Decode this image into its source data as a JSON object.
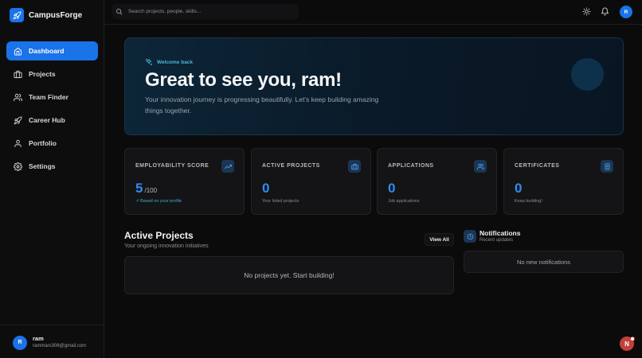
{
  "brand": {
    "name": "CampusForge"
  },
  "sidebar": {
    "items": [
      {
        "label": "Dashboard",
        "icon": "home-icon"
      },
      {
        "label": "Projects",
        "icon": "briefcase-icon"
      },
      {
        "label": "Team Finder",
        "icon": "users-icon"
      },
      {
        "label": "Career Hub",
        "icon": "rocket-icon"
      },
      {
        "label": "Portfolio",
        "icon": "user-icon"
      },
      {
        "label": "Settings",
        "icon": "gear-icon"
      }
    ],
    "active": "Dashboard",
    "user": {
      "initial": "R",
      "name": "ram",
      "email": "rammars306@gmail.com"
    }
  },
  "topbar": {
    "search_placeholder": "Search projects, people, skills...",
    "avatar_initial": "R"
  },
  "hero": {
    "tag": "Welcome back",
    "title": "Great to see you, ram!",
    "subtitle": "Your innovation journey is progressing beautifully. Let's keep building amazing things together."
  },
  "stats": [
    {
      "label": "EMPLOYABILITY SCORE",
      "value": "5",
      "unit": "/100",
      "note": "↗ Based on your profile",
      "icon": "trending-up-icon"
    },
    {
      "label": "ACTIVE PROJECTS",
      "value": "0",
      "unit": "",
      "note": "Your listed projects",
      "icon": "briefcase-icon"
    },
    {
      "label": "APPLICATIONS",
      "value": "0",
      "unit": "",
      "note": "Job applications",
      "icon": "users-icon"
    },
    {
      "label": "CERTIFICATES",
      "value": "0",
      "unit": "",
      "note": "Keep building!",
      "icon": "badge-icon"
    }
  ],
  "projects": {
    "title": "Active Projects",
    "subtitle": "Your ongoing innovation initiatives",
    "view_all": "View All",
    "empty": "No projects yet. Start building!"
  },
  "notifications": {
    "title": "Notifications",
    "subtitle": "Recent updates",
    "empty": "No new notifications"
  },
  "fab": {
    "initial": "N"
  },
  "colors": {
    "accent": "#1a73e8",
    "value": "#2f8cf0",
    "teal": "#39b2d2",
    "background": "#0b0b0c",
    "card": "#141416"
  }
}
